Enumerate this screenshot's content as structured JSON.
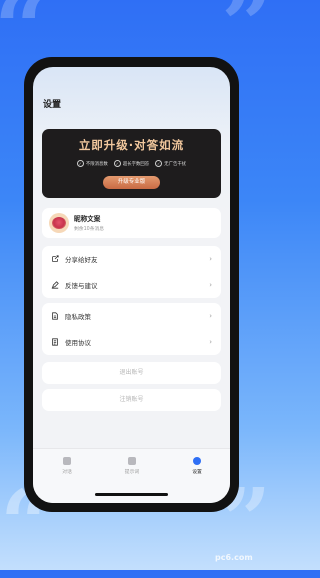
{
  "page": {
    "title": "设置"
  },
  "banner": {
    "title": "立即升级·对答如流",
    "features": [
      "不限消息数",
      "超长字数回答",
      "无广告干扰"
    ],
    "cta": "升级专业版"
  },
  "profile": {
    "nickname": "昵称文案",
    "subtitle": "剩余10条消息"
  },
  "menu": {
    "share": "分享给好友",
    "feedback": "反馈与建议",
    "privacy": "隐私政策",
    "terms": "使用协议"
  },
  "buttons": {
    "logout": "退出账号",
    "cancel_account": "注销账号"
  },
  "tabs": [
    {
      "label": "对话",
      "icon": "chat-icon",
      "active": false
    },
    {
      "label": "提示词",
      "icon": "prompt-icon",
      "active": false
    },
    {
      "label": "设置",
      "icon": "settings-icon",
      "active": true
    }
  ],
  "watermark": "pc6.com",
  "colors": {
    "accent": "#2f6ff5",
    "banner_gold": "#f1c79d",
    "cta_orange": "#d57f55"
  }
}
